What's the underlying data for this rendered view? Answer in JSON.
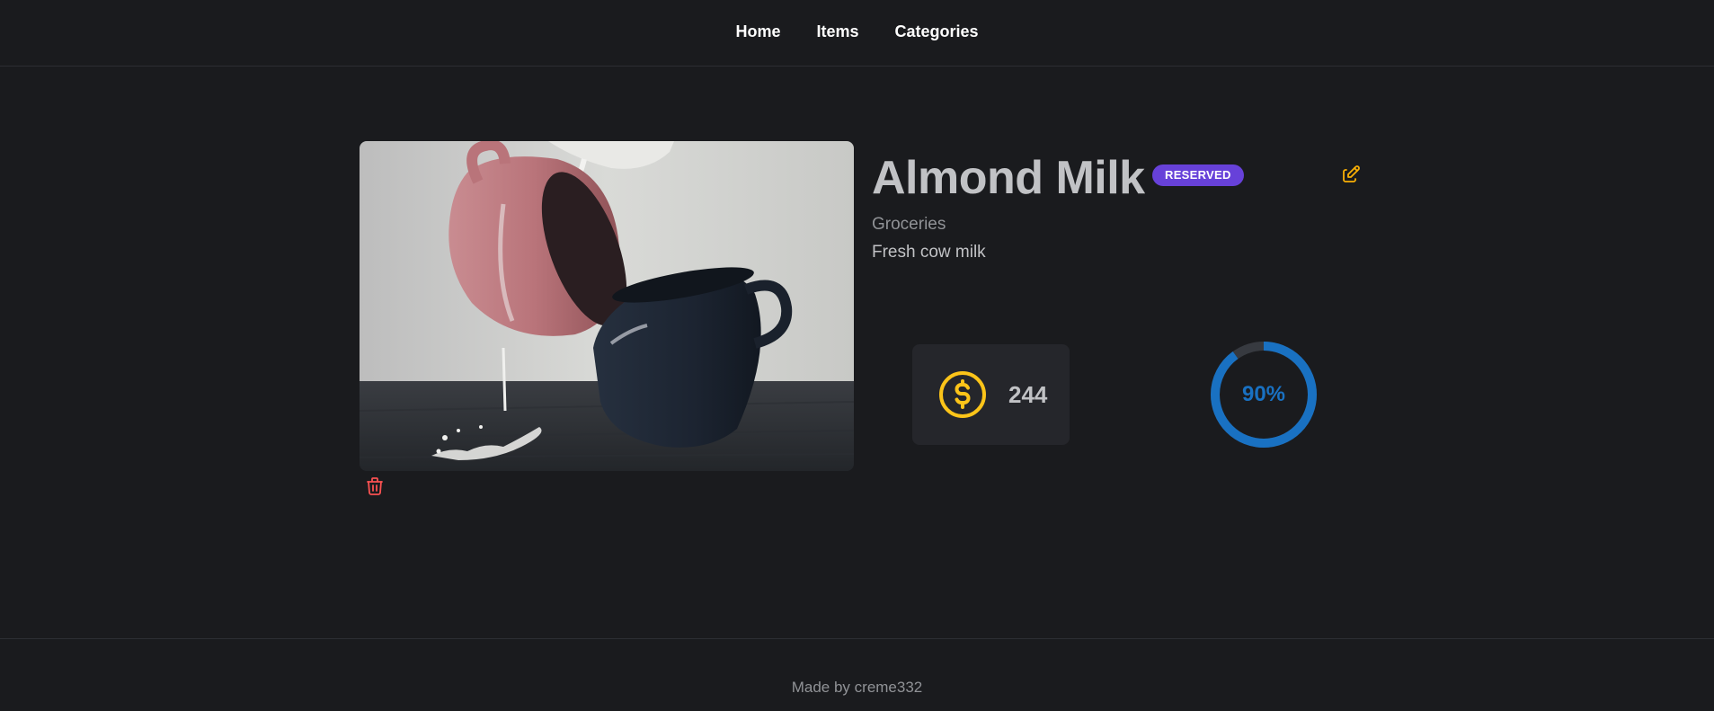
{
  "nav": {
    "items": [
      {
        "label": "Home"
      },
      {
        "label": "Items"
      },
      {
        "label": "Categories"
      }
    ]
  },
  "item": {
    "name": "Almond Milk",
    "status_badge": "RESERVED",
    "category": "Groceries",
    "description": "Fresh cow milk",
    "price": "244",
    "progress_label": "90%",
    "progress_value": 0.9,
    "image_alt": "Milk pouring from a red cup into a dark blue cup"
  },
  "icons": {
    "edit": "pencil-edit-icon",
    "delete": "trash-icon",
    "price": "dollar-coin-icon"
  },
  "colors": {
    "background": "#1a1b1e",
    "card": "#25262b",
    "badge": "#6741d9",
    "accent_edit": "#fab005",
    "accent_delete": "#fa5252",
    "coin": "#fcc419",
    "progress": "#1971c2",
    "progress_track": "#373a40"
  },
  "footer": {
    "text": "Made by creme332"
  }
}
